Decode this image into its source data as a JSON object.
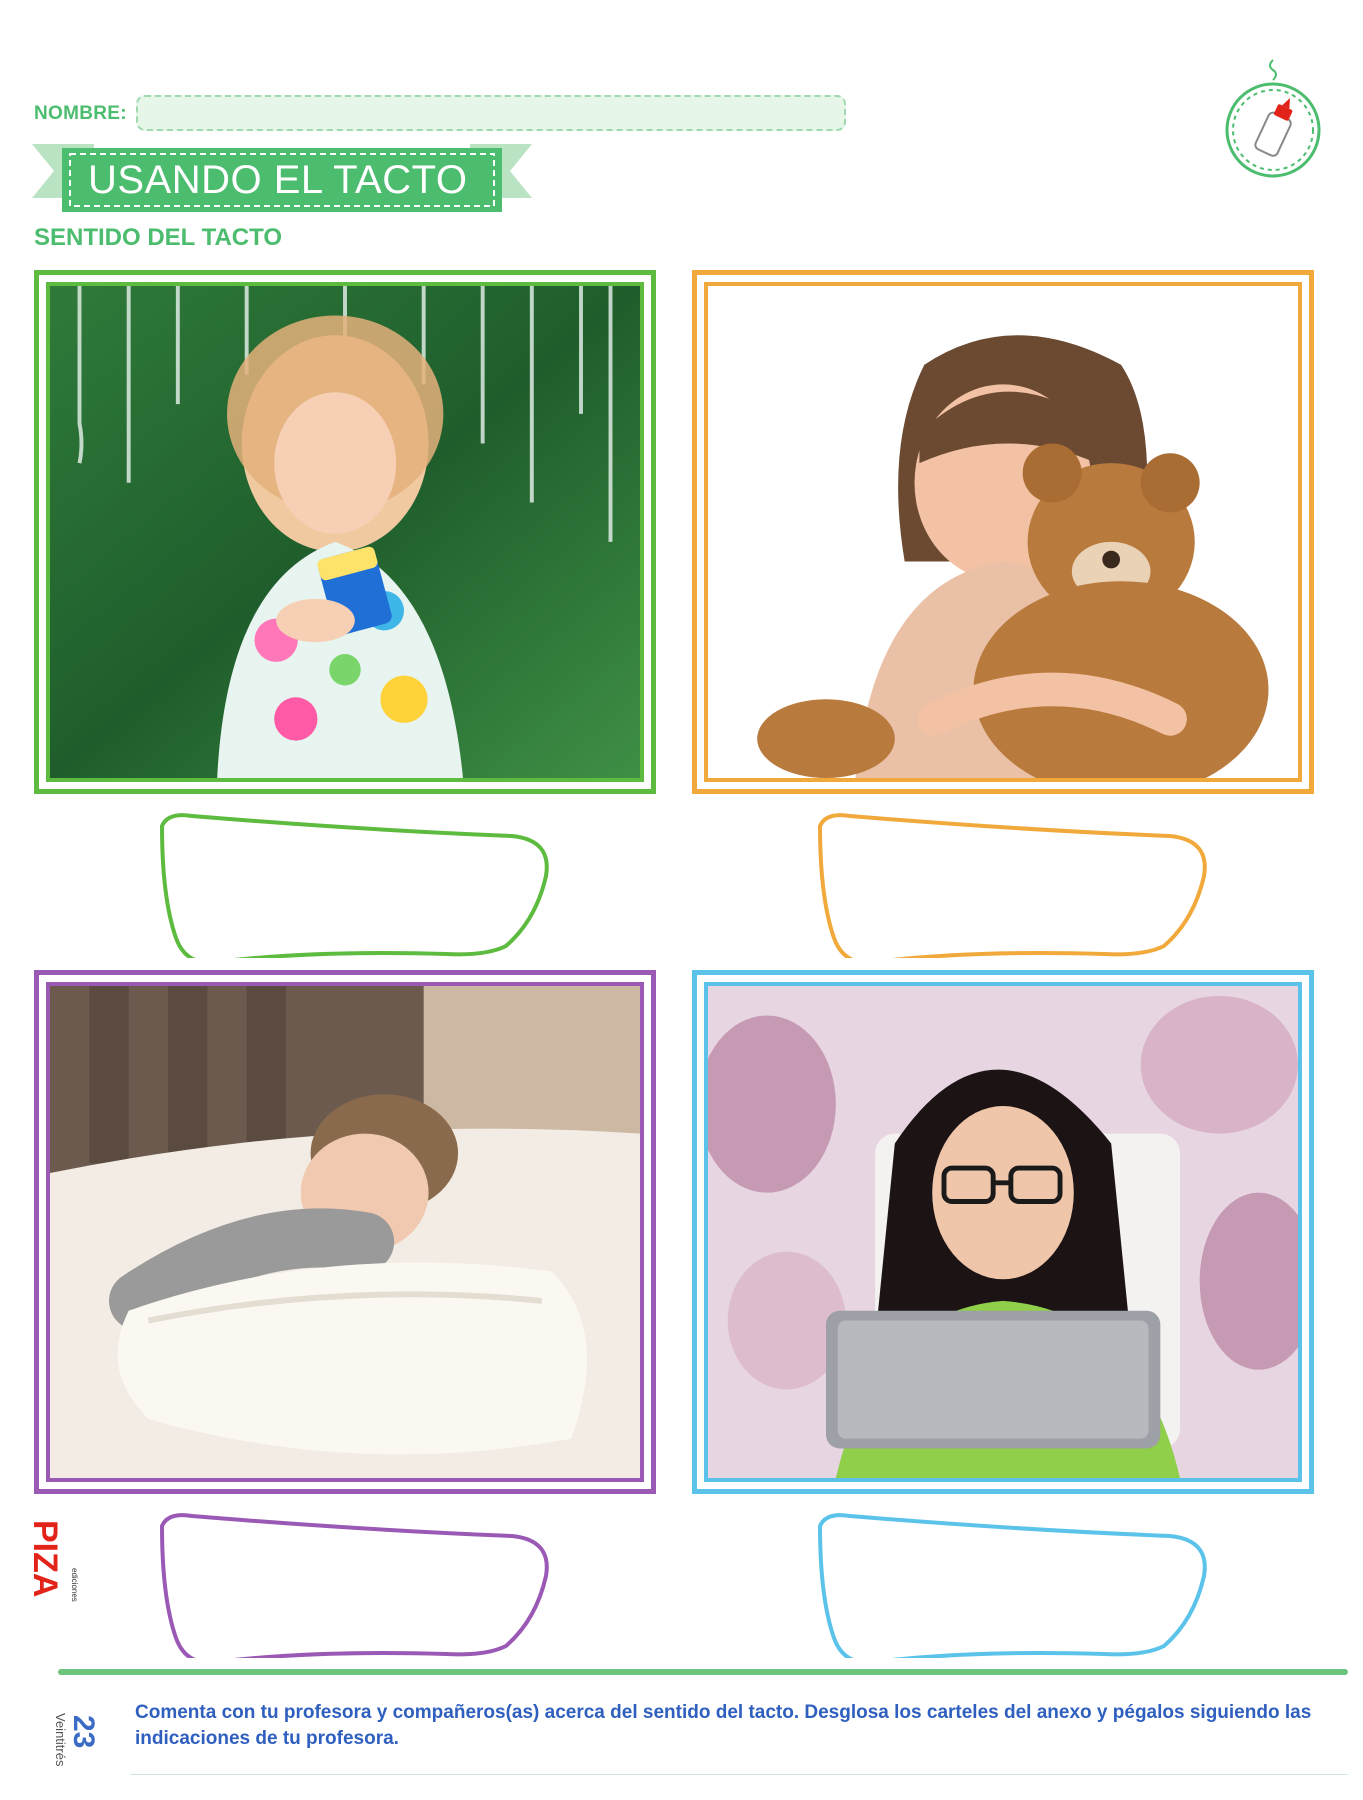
{
  "header": {
    "name_label": "NOMBRE:",
    "name_value": "",
    "title": "USANDO EL TACTO",
    "subtitle": "SENTIDO DEL TACTO",
    "badge_icon": "glue-bottle-icon"
  },
  "colors": {
    "green": "#5dbb3f",
    "orange": "#f2a93b",
    "purple": "#9b59b6",
    "blue": "#5bc3ea",
    "brand_green": "#4cbc6e",
    "text_blue": "#2f5fbf",
    "publisher_red": "#e2231a"
  },
  "pictures": [
    {
      "name": "photo-girl-washing-window",
      "frame_color": "#5dbb3f"
    },
    {
      "name": "photo-girl-hugging-teddy-bear",
      "frame_color": "#f2a93b"
    },
    {
      "name": "photo-girl-on-pillow",
      "frame_color": "#9b59b6"
    },
    {
      "name": "photo-girl-with-tablet",
      "frame_color": "#5bc3ea"
    }
  ],
  "publisher": {
    "logo_text": "PIZA",
    "logo_subtext": "ediciones"
  },
  "footer": {
    "page_number": "23",
    "page_word": "Veintitrés",
    "instructions": "Comenta con tu profesora y compañeros(as) acerca del sentido del tacto. Desglosa los carteles del anexo y pégalos siguiendo las indicaciones de tu profesora."
  }
}
